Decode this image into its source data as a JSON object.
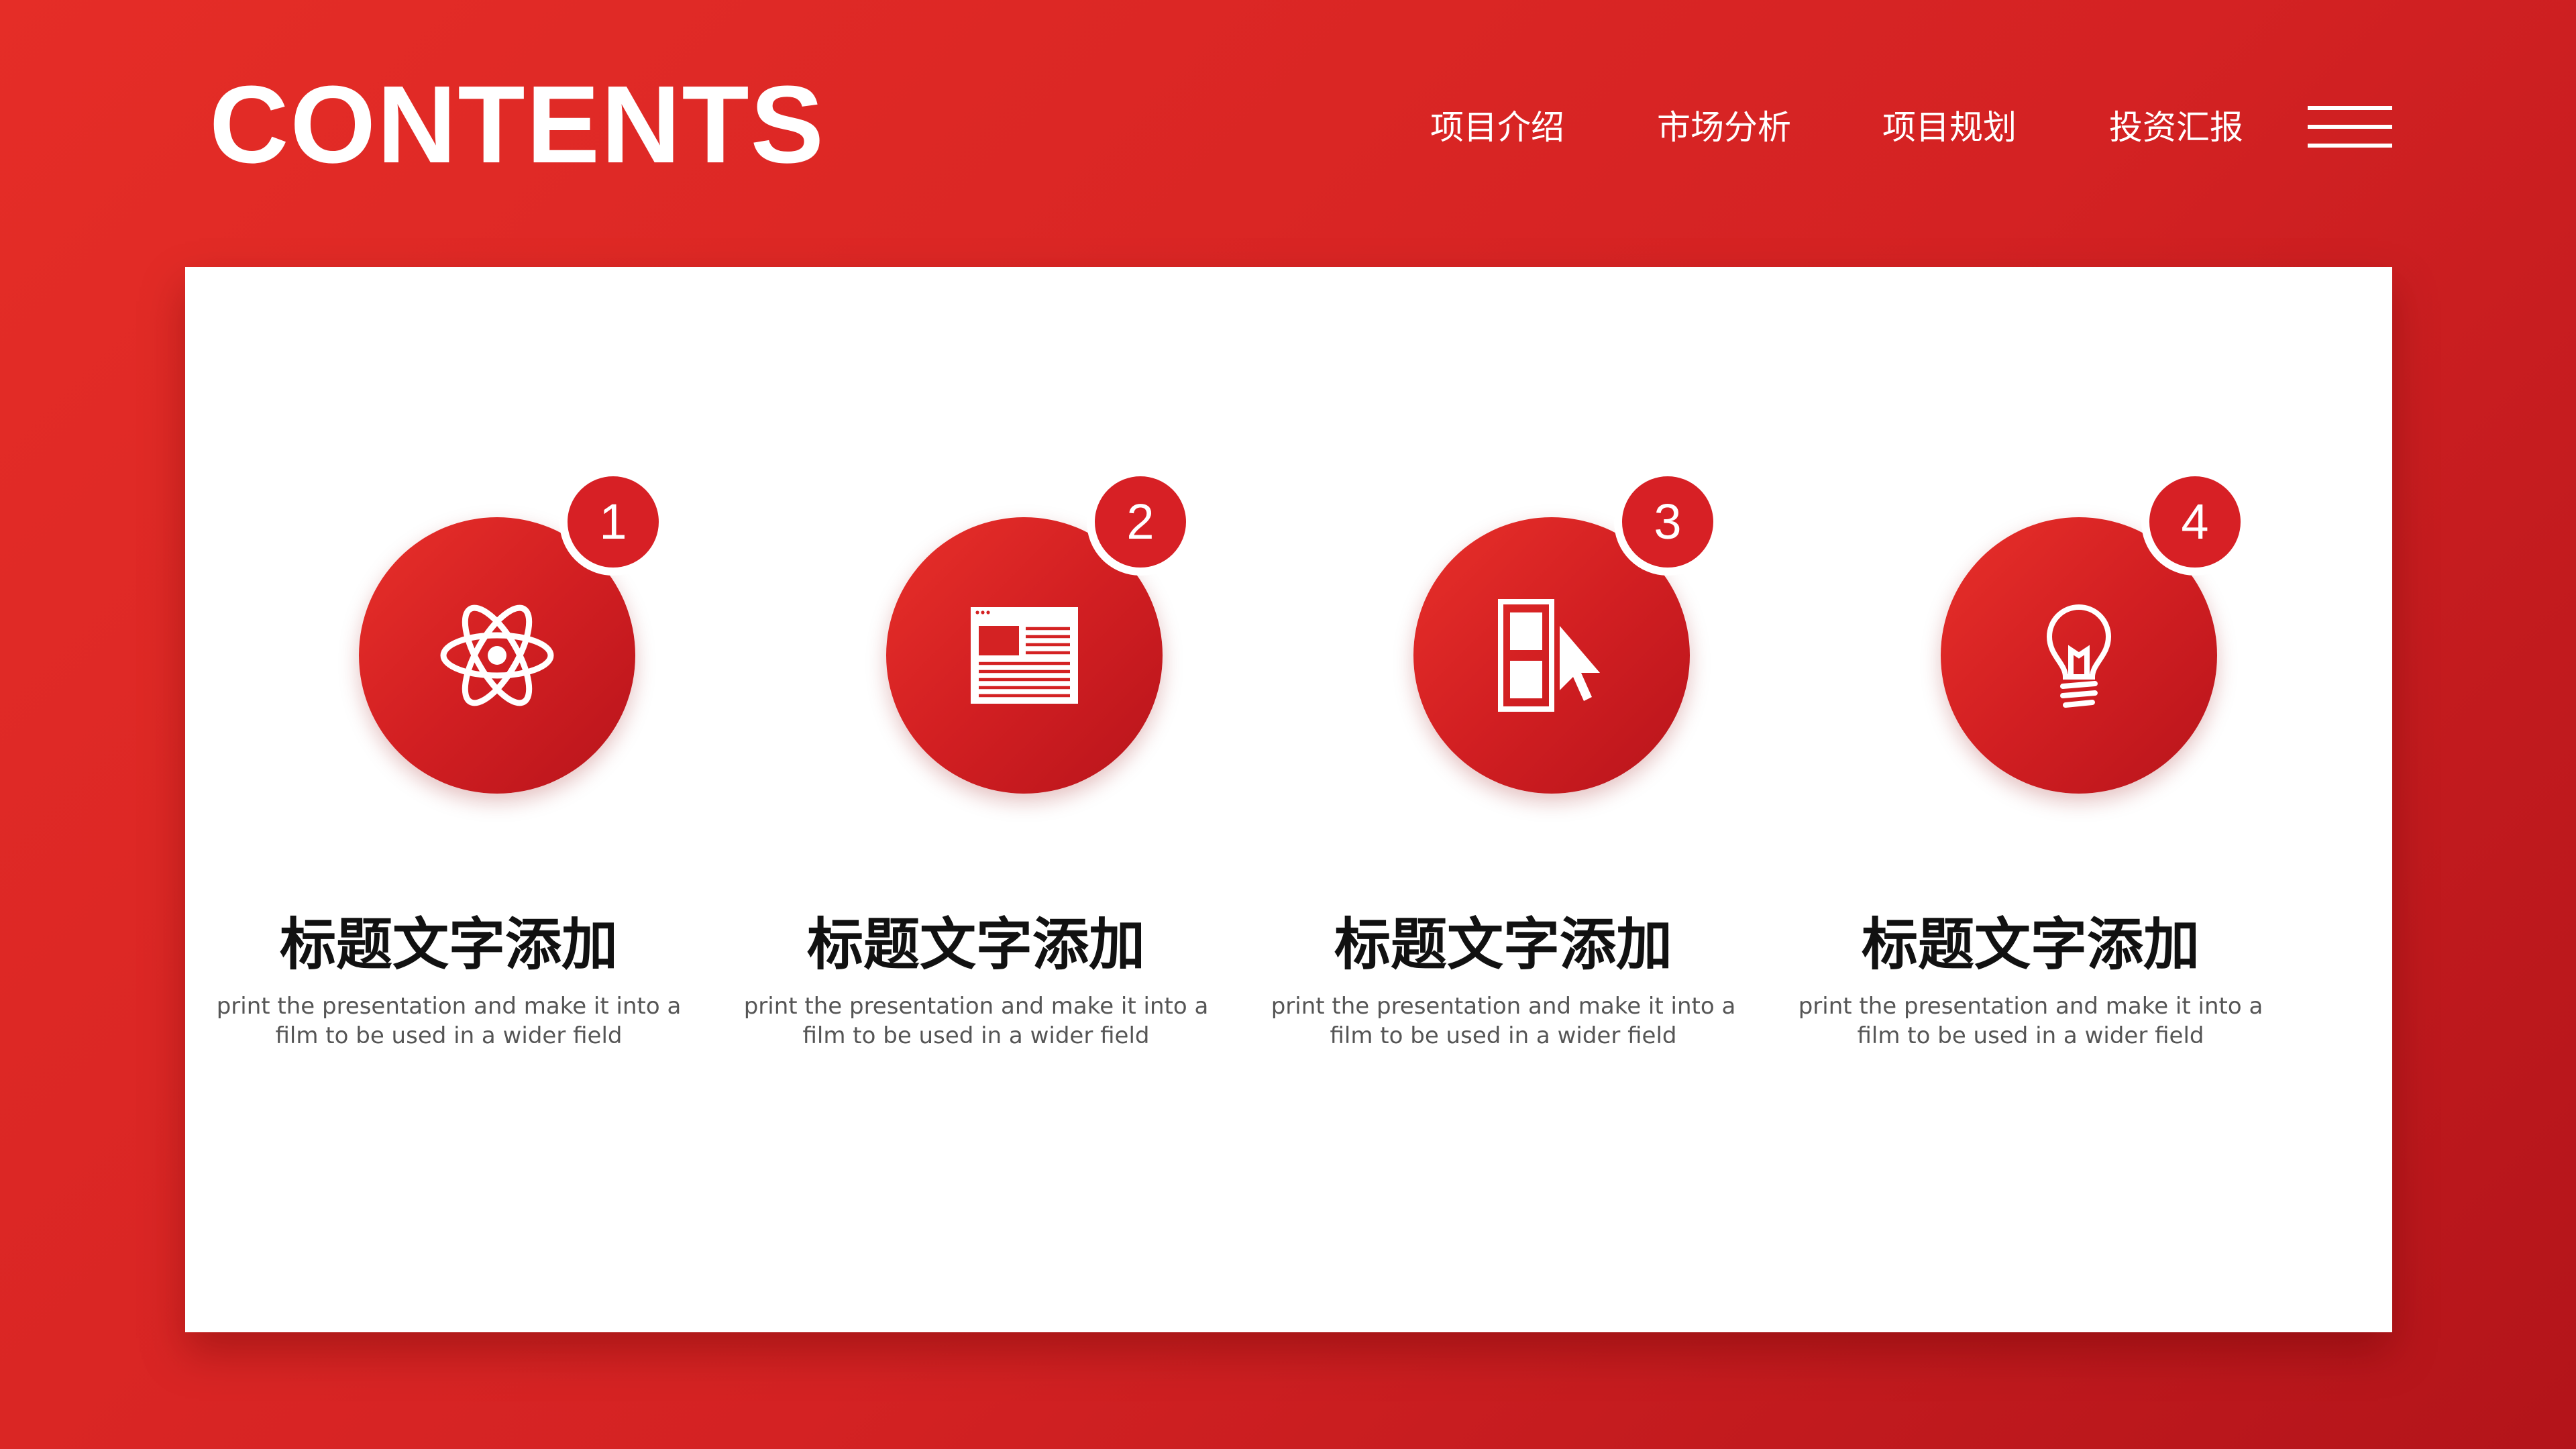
{
  "header": {
    "title": "CONTENTS",
    "nav": [
      "项目介绍",
      "市场分析",
      "项目规划",
      "投资汇报"
    ]
  },
  "icons": {
    "menu": "hamburger-menu-icon",
    "items": [
      "atom-icon",
      "newspaper-icon",
      "cursor-select-icon",
      "lightbulb-icon"
    ]
  },
  "colors": {
    "background": "#d42223",
    "accent": "#d72025",
    "panel": "#ffffff",
    "title_text": "#111111",
    "body_text": "#555555"
  },
  "items": [
    {
      "number": "1",
      "title": "标题文字添加",
      "desc": "print the presentation and make it into a film to be used in a wider field"
    },
    {
      "number": "2",
      "title": "标题文字添加",
      "desc": "print the presentation and make it into a film to be used in a wider field"
    },
    {
      "number": "3",
      "title": "标题文字添加",
      "desc": "print the presentation and make it into a film to be used in a wider field"
    },
    {
      "number": "4",
      "title": "标题文字添加",
      "desc": "print the presentation and make it into a film to be used in a wider field"
    }
  ]
}
